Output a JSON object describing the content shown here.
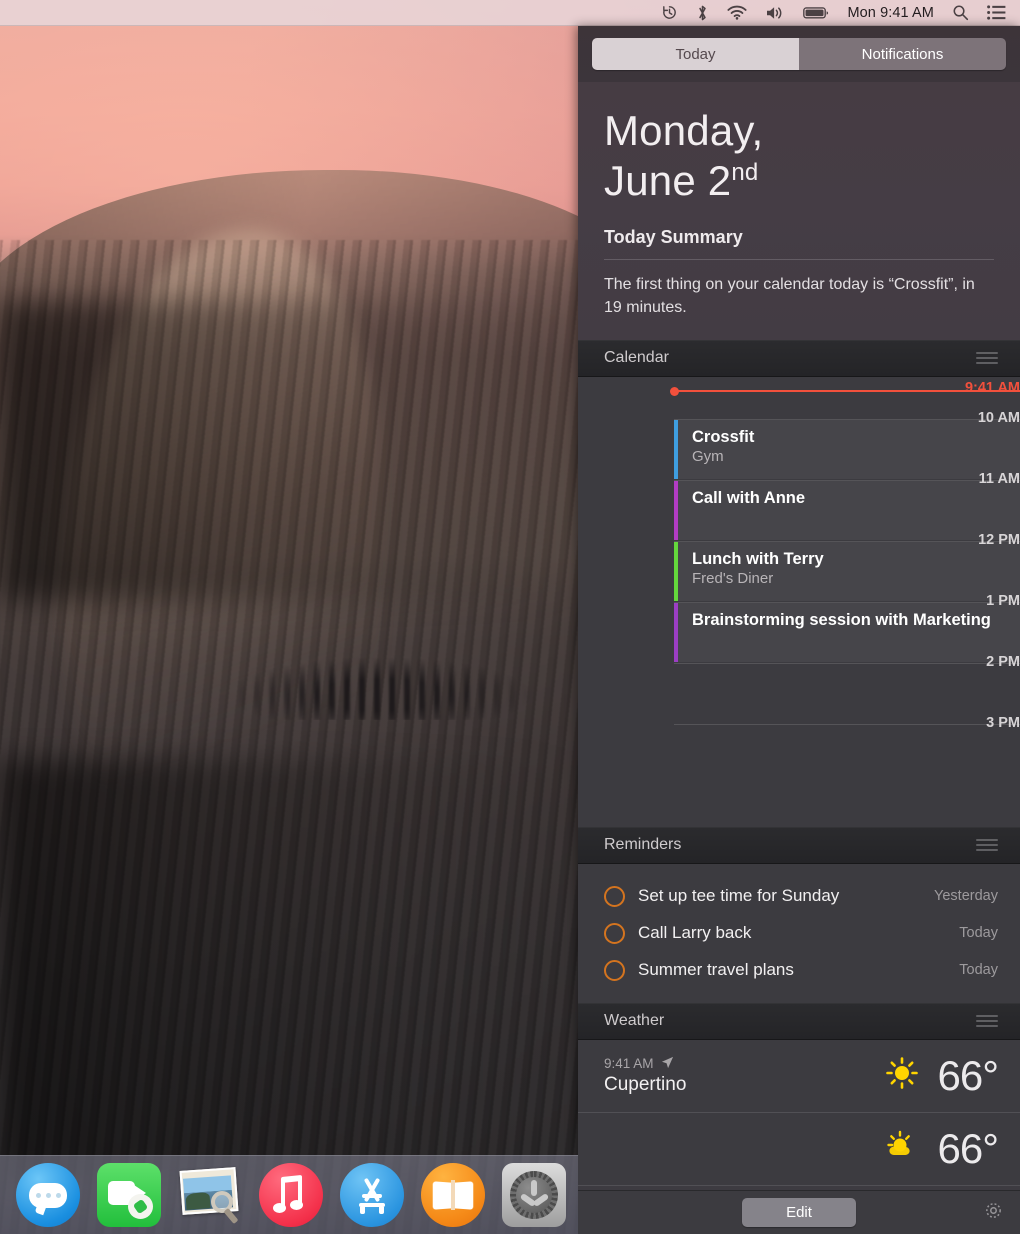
{
  "menubar": {
    "icons": [
      "time-machine-icon",
      "bluetooth-icon",
      "wifi-icon",
      "volume-icon",
      "battery-icon"
    ],
    "clock": "Mon 9:41 AM",
    "right_icons": [
      "spotlight-search-icon",
      "notification-center-icon"
    ]
  },
  "notification_center": {
    "tabs": [
      {
        "label": "Today",
        "selected": true
      },
      {
        "label": "Notifications",
        "selected": false
      }
    ],
    "date": {
      "line1": "Monday,",
      "line2_month_day": "June 2",
      "ordinal": "nd"
    },
    "summary": {
      "title": "Today Summary",
      "body": "The first thing on your calendar today is “Crossfit”, in 19 minutes."
    },
    "calendar": {
      "section_title": "Calendar",
      "now_label": "9:41 AM",
      "now_color": "#f2503c",
      "hours": [
        "10 AM",
        "11 AM",
        "12 PM",
        "1 PM",
        "2 PM",
        "3 PM"
      ],
      "events": [
        {
          "title": "Crossfit",
          "location": "Gym",
          "color": "#3f9ee0",
          "start_hour_index": 0,
          "duration_hours": 1
        },
        {
          "title": "Call with Anne",
          "location": "",
          "color": "#b23cc4",
          "start_hour_index": 1,
          "duration_hours": 1
        },
        {
          "title": "Lunch with Terry",
          "location": "Fred's Diner",
          "color": "#64d83c",
          "start_hour_index": 2,
          "duration_hours": 1
        },
        {
          "title": "Brainstorming session with Marketing",
          "location": "",
          "color": "#9c3ec4",
          "start_hour_index": 3,
          "duration_hours": 1
        }
      ]
    },
    "reminders": {
      "section_title": "Reminders",
      "check_color": "#d4741f",
      "items": [
        {
          "text": "Set up tee time for Sunday",
          "when": "Yesterday"
        },
        {
          "text": "Call Larry back",
          "when": "Today"
        },
        {
          "text": "Summer travel plans",
          "when": "Today"
        }
      ]
    },
    "weather": {
      "section_title": "Weather",
      "rows": [
        {
          "time": "9:41 AM",
          "location_icon": "location-arrow-icon",
          "city": "Cupertino",
          "condition_icon": "sun-icon",
          "temperature": "66°"
        },
        {
          "time": "",
          "location_icon": "",
          "city": "",
          "condition_icon": "sun-behind-cloud-icon",
          "temperature": "66°"
        }
      ]
    },
    "footer": {
      "edit_label": "Edit",
      "gear_icon": "gear-icon"
    }
  },
  "dock": {
    "items": [
      {
        "name": "messages",
        "label": "Messages"
      },
      {
        "name": "facetime",
        "label": "FaceTime"
      },
      {
        "name": "preview",
        "label": "Preview"
      },
      {
        "name": "itunes",
        "label": "iTunes"
      },
      {
        "name": "app-store",
        "label": "App Store"
      },
      {
        "name": "ibooks",
        "label": "iBooks"
      },
      {
        "name": "system-preferences",
        "label": "System Preferences"
      }
    ]
  }
}
